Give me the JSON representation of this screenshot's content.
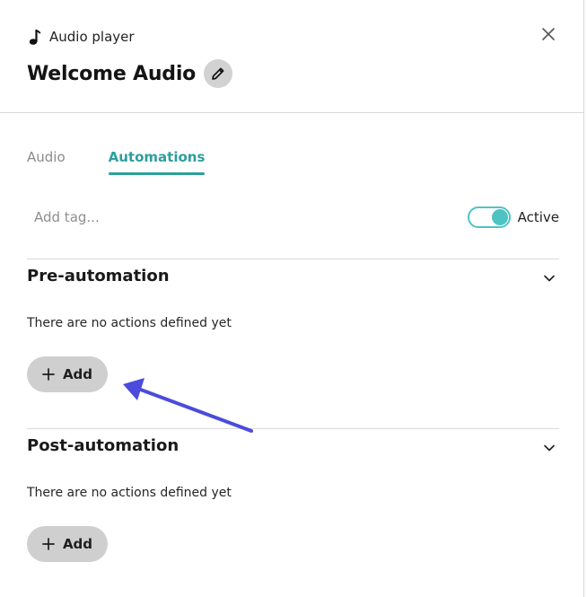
{
  "header": {
    "kind_label": "Audio player",
    "title": "Welcome Audio"
  },
  "tabs": [
    {
      "label": "Audio",
      "active": false
    },
    {
      "label": "Automations",
      "active": true
    }
  ],
  "tags": {
    "placeholder": "Add tag..."
  },
  "status": {
    "label": "Active",
    "on": true
  },
  "sections": [
    {
      "title": "Pre-automation",
      "empty_text": "There are no actions defined yet",
      "add_label": "Add"
    },
    {
      "title": "Post-automation",
      "empty_text": "There are no actions defined yet",
      "add_label": "Add"
    }
  ],
  "icons": {
    "kind": "music-note-icon",
    "close": "close-icon",
    "edit": "pencil-icon",
    "expand": "chevron-down-icon",
    "add": "plus-icon"
  },
  "colors": {
    "accent": "#2e9e9e",
    "toggle": "#4fc3c3",
    "annotation_arrow": "#4b4bdc",
    "button_bg": "#cfcfcf"
  }
}
